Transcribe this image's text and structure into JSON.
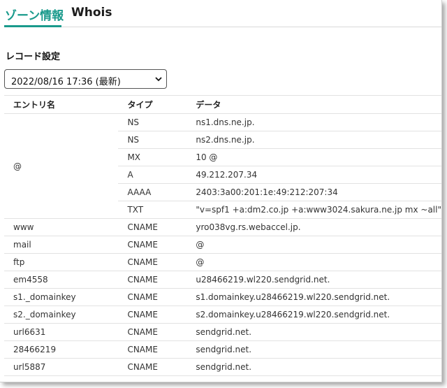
{
  "tabs": [
    {
      "label": "ゾーン情報",
      "active": true
    },
    {
      "label": "Whois",
      "active": false
    }
  ],
  "section_title": "レコード設定",
  "record_select": {
    "value": "2022/08/16 17:36 (最新)"
  },
  "table": {
    "headers": [
      "エントリ名",
      "タイプ",
      "データ"
    ],
    "groups": [
      {
        "name": "@",
        "rows": [
          {
            "type": "NS",
            "data": "ns1.dns.ne.jp."
          },
          {
            "type": "NS",
            "data": "ns2.dns.ne.jp."
          },
          {
            "type": "MX",
            "data": "10 @"
          },
          {
            "type": "A",
            "data": "49.212.207.34"
          },
          {
            "type": "AAAA",
            "data": "2403:3a00:201:1e:49:212:207:34"
          },
          {
            "type": "TXT",
            "data": "\"v=spf1 +a:dm2.co.jp +a:www3024.sakura.ne.jp mx ~all\""
          }
        ]
      },
      {
        "name": "www",
        "rows": [
          {
            "type": "CNAME",
            "data": "yro038vg.rs.webaccel.jp."
          }
        ]
      },
      {
        "name": "mail",
        "rows": [
          {
            "type": "CNAME",
            "data": "@"
          }
        ]
      },
      {
        "name": "ftp",
        "rows": [
          {
            "type": "CNAME",
            "data": "@"
          }
        ]
      },
      {
        "name": "em4558",
        "rows": [
          {
            "type": "CNAME",
            "data": "u28466219.wl220.sendgrid.net."
          }
        ]
      },
      {
        "name": "s1._domainkey",
        "rows": [
          {
            "type": "CNAME",
            "data": "s1.domainkey.u28466219.wl220.sendgrid.net."
          }
        ]
      },
      {
        "name": "s2._domainkey",
        "rows": [
          {
            "type": "CNAME",
            "data": "s2.domainkey.u28466219.wl220.sendgrid.net."
          }
        ]
      },
      {
        "name": "url6631",
        "rows": [
          {
            "type": "CNAME",
            "data": "sendgrid.net."
          }
        ]
      },
      {
        "name": "28466219",
        "rows": [
          {
            "type": "CNAME",
            "data": "sendgrid.net."
          }
        ]
      },
      {
        "name": "url5887",
        "rows": [
          {
            "type": "CNAME",
            "data": "sendgrid.net."
          }
        ]
      }
    ]
  },
  "colors": {
    "accent": "#1a9a8c"
  }
}
